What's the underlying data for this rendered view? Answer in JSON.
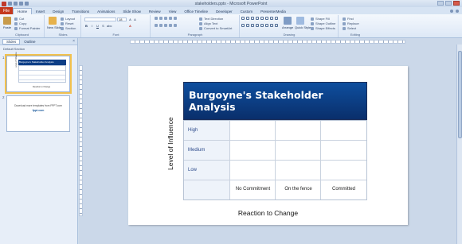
{
  "window": {
    "title": "stakeholders.pptx - Microsoft PowerPoint"
  },
  "tabs": [
    "File",
    "Home",
    "Insert",
    "Design",
    "Transitions",
    "Animations",
    "Slide Show",
    "Review",
    "View",
    "Office Timeline",
    "Developer",
    "Custom",
    "PresenterMedia"
  ],
  "ribbon": {
    "clipboard": {
      "label": "Clipboard",
      "paste": "Paste",
      "cut": "Cut",
      "copy": "Copy",
      "format_painter": "Format Painter"
    },
    "slides": {
      "label": "Slides",
      "new_slide": "New Slide",
      "layout": "Layout",
      "reset": "Reset",
      "section": "Section"
    },
    "font": {
      "label": "Font",
      "font_name": "",
      "font_size": "18"
    },
    "paragraph": {
      "label": "Paragraph",
      "text_direction": "Text Direction",
      "align_text": "Align Text",
      "convert_smartart": "Convert to SmartArt"
    },
    "drawing": {
      "label": "Drawing",
      "arrange": "Arrange",
      "quick_styles": "Quick Styles",
      "shape_fill": "Shape Fill",
      "shape_outline": "Shape Outline",
      "shape_effects": "Shape Effects"
    },
    "editing": {
      "label": "Editing",
      "find": "Find",
      "replace": "Replace",
      "select": "Select"
    }
  },
  "panel": {
    "tabs": [
      "Slides",
      "Outline"
    ],
    "close": "×",
    "section_name": "Default Section",
    "slide1": {
      "num": "1",
      "title": "Burgoyne's Stakeholder Analysis",
      "y": "Level of Influence",
      "x": "Reaction to Change"
    },
    "slide2": {
      "num": "2",
      "text": "Download more templates from FPPT.com",
      "link": "fppt.com"
    }
  },
  "slide": {
    "title": "Burgoyne's Stakeholder Analysis",
    "rows": [
      "High",
      "Medium",
      "Low"
    ],
    "columns": [
      "No Commitment",
      "On the fence",
      "Committed"
    ],
    "y_axis": "Level of Influence",
    "x_axis": "Reaction to Change"
  }
}
